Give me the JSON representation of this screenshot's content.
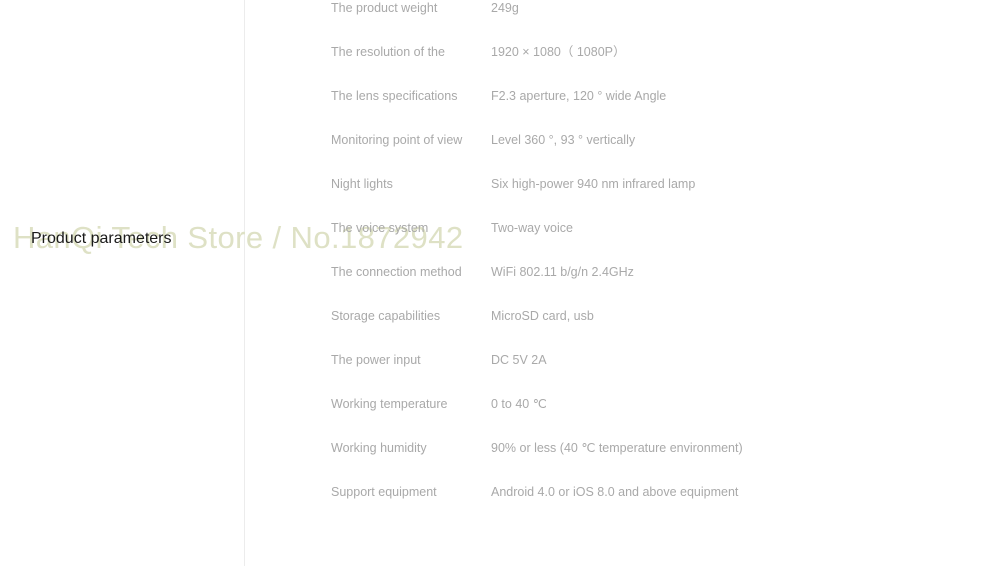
{
  "watermark": {
    "text": "HanQi Tech Store / No.1872942",
    "color": "#dee1c5"
  },
  "section": {
    "title": "Product parameters",
    "title_color": "#1a1a1a"
  },
  "divider": {
    "color": "#ececec"
  },
  "spec_table": {
    "text_color": "#a9a9a9",
    "rows": [
      {
        "label": "The product weight",
        "value": "249g"
      },
      {
        "label": "The resolution of the",
        "value": "1920 × 1080（ 1080P）"
      },
      {
        "label": "The lens specifications",
        "value": "F2.3 aperture, 120 ° wide Angle"
      },
      {
        "label": "Monitoring point of view",
        "value": "Level 360 °, 93 ° vertically"
      },
      {
        "label": "Night lights",
        "value": "Six high-power 940 nm infrared lamp"
      },
      {
        "label": "The voice system",
        "value": "Two-way voice"
      },
      {
        "label": "The connection method",
        "value": "WiFi 802.11 b/g/n 2.4GHz"
      },
      {
        "label": "Storage capabilities",
        "value": "MicroSD card, usb"
      },
      {
        "label": "The power input",
        "value": "DC 5V 2A"
      },
      {
        "label": "Working temperature",
        "value": "0 to 40 ℃"
      },
      {
        "label": "Working humidity",
        "value": "90% or less (40 ℃ temperature environment)"
      },
      {
        "label": "Support equipment",
        "value": "Android 4.0 or iOS 8.0 and above equipment"
      }
    ]
  }
}
